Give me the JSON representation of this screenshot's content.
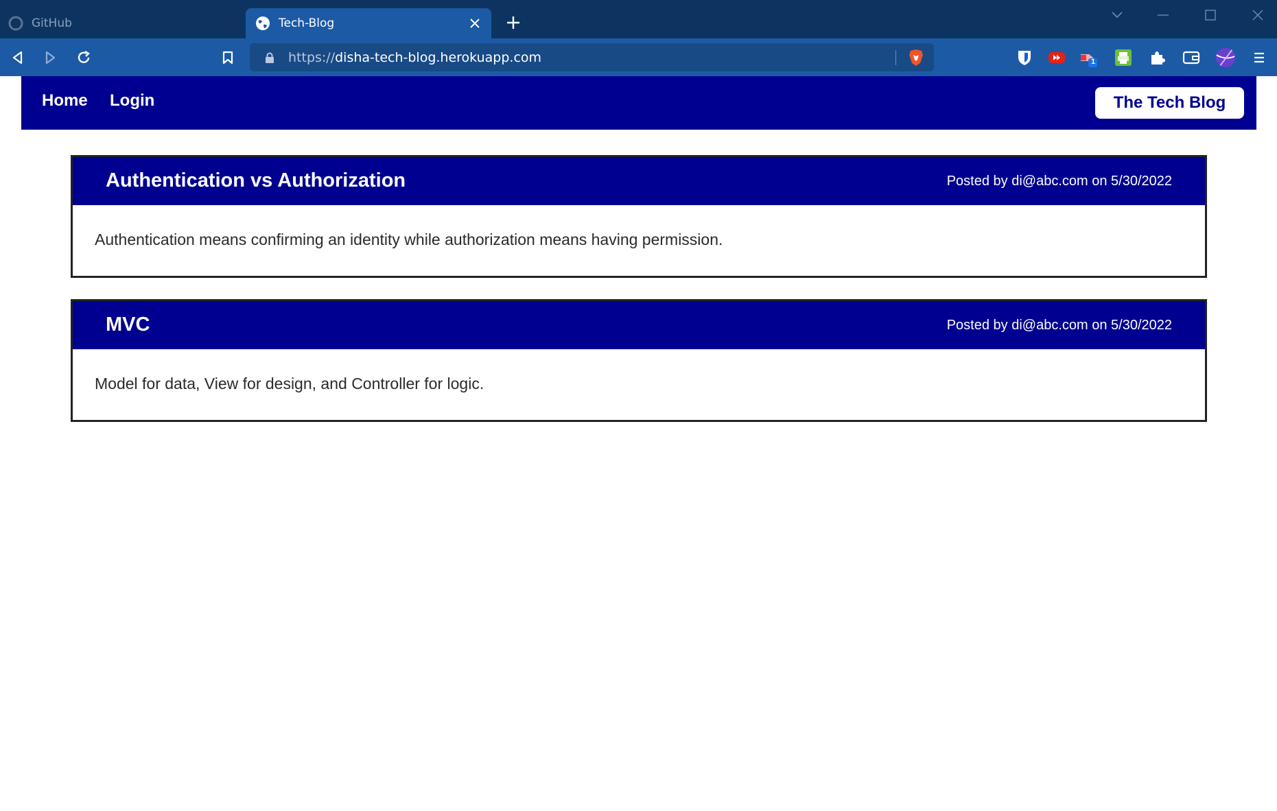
{
  "browser": {
    "tabs": [
      {
        "title": "GitHub",
        "active": false
      },
      {
        "title": "Tech-Blog",
        "active": true
      }
    ],
    "url_scheme": "https://",
    "url_host": "disha-tech-blog.herokuapp.com",
    "extension_badge": "1",
    "colors": {
      "tabstrip": "#0d3461",
      "toolbar": "#1d5aa5",
      "urlbar": "#184a86"
    }
  },
  "site": {
    "nav": {
      "home": "Home",
      "login": "Login",
      "brand": "The Tech Blog"
    },
    "posts": [
      {
        "title": "Authentication vs Authorization",
        "meta": "Posted by di@abc.com on 5/30/2022",
        "body": "Authentication means confirming an identity while authorization means having permission."
      },
      {
        "title": "MVC",
        "meta": "Posted by di@abc.com on 5/30/2022",
        "body": "Model for data, View for design, and Controller for logic."
      }
    ],
    "colors": {
      "primary": "#000090",
      "border": "#222222"
    }
  }
}
